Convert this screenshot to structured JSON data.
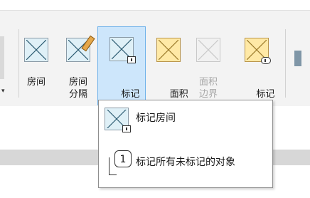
{
  "ribbon": {
    "buttons": [
      {
        "id": "room",
        "label": "房间",
        "has_caret": false
      },
      {
        "id": "room-separator",
        "label": "房间\n分隔",
        "has_caret": false
      },
      {
        "id": "tag-room",
        "label": "标记\n房间",
        "has_caret": true,
        "active": true
      },
      {
        "id": "area",
        "label": "面积",
        "has_caret": true
      },
      {
        "id": "area-boundary",
        "label": "面积\n边界",
        "has_caret": false,
        "disabled": true
      },
      {
        "id": "tag-area",
        "label": "标记\n面积",
        "has_caret": true
      }
    ]
  },
  "dropdown": {
    "items": [
      {
        "label": "标记房间"
      },
      {
        "label": "标记所有未标记的对象"
      }
    ],
    "tag_all_badge": "1"
  },
  "icons": {
    "room": "room-icon",
    "room_separator": "room-separator-icon",
    "tag_room": "tag-room-icon",
    "area": "area-icon",
    "area_boundary": "area-boundary-icon",
    "tag_area": "tag-area-icon",
    "tag_all": "tag-all-icon"
  }
}
